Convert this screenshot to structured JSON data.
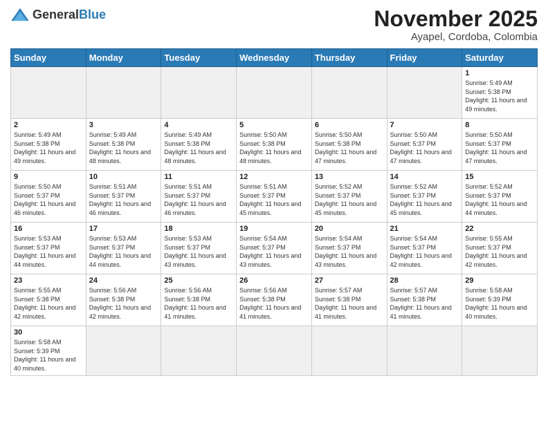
{
  "logo": {
    "general": "General",
    "blue": "Blue"
  },
  "header": {
    "month": "November 2025",
    "location": "Ayapel, Cordoba, Colombia"
  },
  "weekdays": [
    "Sunday",
    "Monday",
    "Tuesday",
    "Wednesday",
    "Thursday",
    "Friday",
    "Saturday"
  ],
  "weeks": [
    [
      {
        "day": "",
        "empty": true
      },
      {
        "day": "",
        "empty": true
      },
      {
        "day": "",
        "empty": true
      },
      {
        "day": "",
        "empty": true
      },
      {
        "day": "",
        "empty": true
      },
      {
        "day": "",
        "empty": true
      },
      {
        "day": "1",
        "sunrise": "5:49 AM",
        "sunset": "5:38 PM",
        "daylight": "11 hours and 49 minutes."
      }
    ],
    [
      {
        "day": "2",
        "sunrise": "5:49 AM",
        "sunset": "5:38 PM",
        "daylight": "11 hours and 49 minutes."
      },
      {
        "day": "3",
        "sunrise": "5:49 AM",
        "sunset": "5:38 PM",
        "daylight": "11 hours and 48 minutes."
      },
      {
        "day": "4",
        "sunrise": "5:49 AM",
        "sunset": "5:38 PM",
        "daylight": "11 hours and 48 minutes."
      },
      {
        "day": "5",
        "sunrise": "5:50 AM",
        "sunset": "5:38 PM",
        "daylight": "11 hours and 48 minutes."
      },
      {
        "day": "6",
        "sunrise": "5:50 AM",
        "sunset": "5:38 PM",
        "daylight": "11 hours and 47 minutes."
      },
      {
        "day": "7",
        "sunrise": "5:50 AM",
        "sunset": "5:37 PM",
        "daylight": "11 hours and 47 minutes."
      },
      {
        "day": "8",
        "sunrise": "5:50 AM",
        "sunset": "5:37 PM",
        "daylight": "11 hours and 47 minutes."
      }
    ],
    [
      {
        "day": "9",
        "sunrise": "5:50 AM",
        "sunset": "5:37 PM",
        "daylight": "11 hours and 46 minutes."
      },
      {
        "day": "10",
        "sunrise": "5:51 AM",
        "sunset": "5:37 PM",
        "daylight": "11 hours and 46 minutes."
      },
      {
        "day": "11",
        "sunrise": "5:51 AM",
        "sunset": "5:37 PM",
        "daylight": "11 hours and 46 minutes."
      },
      {
        "day": "12",
        "sunrise": "5:51 AM",
        "sunset": "5:37 PM",
        "daylight": "11 hours and 45 minutes."
      },
      {
        "day": "13",
        "sunrise": "5:52 AM",
        "sunset": "5:37 PM",
        "daylight": "11 hours and 45 minutes."
      },
      {
        "day": "14",
        "sunrise": "5:52 AM",
        "sunset": "5:37 PM",
        "daylight": "11 hours and 45 minutes."
      },
      {
        "day": "15",
        "sunrise": "5:52 AM",
        "sunset": "5:37 PM",
        "daylight": "11 hours and 44 minutes."
      }
    ],
    [
      {
        "day": "16",
        "sunrise": "5:53 AM",
        "sunset": "5:37 PM",
        "daylight": "11 hours and 44 minutes."
      },
      {
        "day": "17",
        "sunrise": "5:53 AM",
        "sunset": "5:37 PM",
        "daylight": "11 hours and 44 minutes."
      },
      {
        "day": "18",
        "sunrise": "5:53 AM",
        "sunset": "5:37 PM",
        "daylight": "11 hours and 43 minutes."
      },
      {
        "day": "19",
        "sunrise": "5:54 AM",
        "sunset": "5:37 PM",
        "daylight": "11 hours and 43 minutes."
      },
      {
        "day": "20",
        "sunrise": "5:54 AM",
        "sunset": "5:37 PM",
        "daylight": "11 hours and 43 minutes."
      },
      {
        "day": "21",
        "sunrise": "5:54 AM",
        "sunset": "5:37 PM",
        "daylight": "11 hours and 42 minutes."
      },
      {
        "day": "22",
        "sunrise": "5:55 AM",
        "sunset": "5:37 PM",
        "daylight": "11 hours and 42 minutes."
      }
    ],
    [
      {
        "day": "23",
        "sunrise": "5:55 AM",
        "sunset": "5:38 PM",
        "daylight": "11 hours and 42 minutes."
      },
      {
        "day": "24",
        "sunrise": "5:56 AM",
        "sunset": "5:38 PM",
        "daylight": "11 hours and 42 minutes."
      },
      {
        "day": "25",
        "sunrise": "5:56 AM",
        "sunset": "5:38 PM",
        "daylight": "11 hours and 41 minutes."
      },
      {
        "day": "26",
        "sunrise": "5:56 AM",
        "sunset": "5:38 PM",
        "daylight": "11 hours and 41 minutes."
      },
      {
        "day": "27",
        "sunrise": "5:57 AM",
        "sunset": "5:38 PM",
        "daylight": "11 hours and 41 minutes."
      },
      {
        "day": "28",
        "sunrise": "5:57 AM",
        "sunset": "5:38 PM",
        "daylight": "11 hours and 41 minutes."
      },
      {
        "day": "29",
        "sunrise": "5:58 AM",
        "sunset": "5:39 PM",
        "daylight": "11 hours and 40 minutes."
      }
    ],
    [
      {
        "day": "30",
        "sunrise": "5:58 AM",
        "sunset": "5:39 PM",
        "daylight": "11 hours and 40 minutes."
      },
      {
        "day": "",
        "empty": true
      },
      {
        "day": "",
        "empty": true
      },
      {
        "day": "",
        "empty": true
      },
      {
        "day": "",
        "empty": true
      },
      {
        "day": "",
        "empty": true
      },
      {
        "day": "",
        "empty": true
      }
    ]
  ],
  "labels": {
    "sunrise": "Sunrise:",
    "sunset": "Sunset:",
    "daylight": "Daylight:"
  }
}
